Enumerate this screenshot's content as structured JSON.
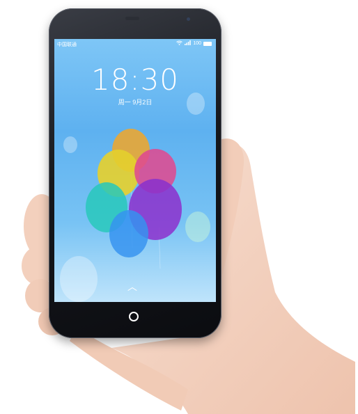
{
  "status_bar": {
    "carrier": "中国联通",
    "battery": "100",
    "wifi_icon": "wifi-icon",
    "signal_icon": "signal-icon",
    "battery_icon": "battery-icon"
  },
  "lockscreen": {
    "time": "18:30",
    "date": "周一  9月2日",
    "unlock_icon": "chevron-up-icon"
  },
  "device": {
    "home_button_icon": "home-ring-icon"
  },
  "colors": {
    "screen_top": "#7ec6f6",
    "balloon_orange": "#f5a623",
    "balloon_yellow": "#f2d21a",
    "balloon_pink": "#ec3f86",
    "balloon_teal": "#20c9b5",
    "balloon_purple": "#8e24c9",
    "balloon_blue": "#2f8ef0"
  }
}
